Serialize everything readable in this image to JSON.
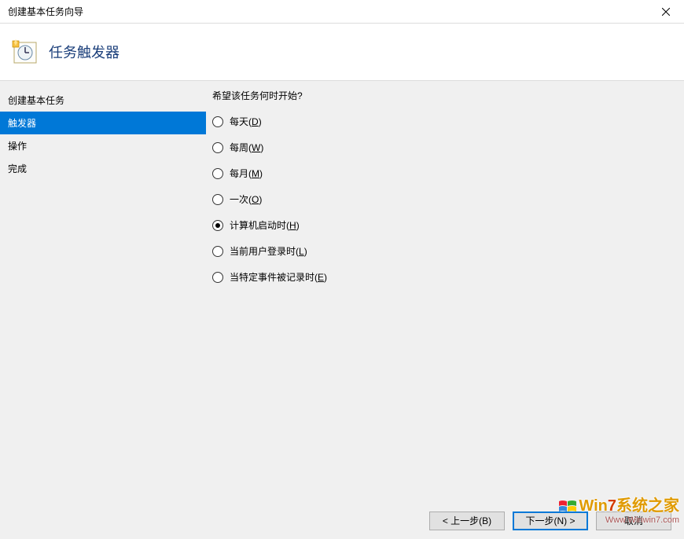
{
  "window": {
    "title": "创建基本任务向导"
  },
  "header": {
    "title": "任务触发器"
  },
  "sidebar": {
    "items": [
      {
        "label": "创建基本任务"
      },
      {
        "label": "触发器"
      },
      {
        "label": "操作"
      },
      {
        "label": "完成"
      }
    ],
    "selectedIndex": 1
  },
  "content": {
    "question": "希望该任务何时开始?",
    "options": [
      {
        "label": "每天",
        "accel": "D"
      },
      {
        "label": "每周",
        "accel": "W"
      },
      {
        "label": "每月",
        "accel": "M"
      },
      {
        "label": "一次",
        "accel": "O"
      },
      {
        "label": "计算机启动时",
        "accel": "H"
      },
      {
        "label": "当前用户登录时",
        "accel": "L"
      },
      {
        "label": "当特定事件被记录时",
        "accel": "E"
      }
    ],
    "selectedIndex": 4
  },
  "footer": {
    "back": "< 上一步(B)",
    "next": "下一步(N) >",
    "cancel": "取消"
  },
  "watermark": {
    "line1_prefix": "Win",
    "line1_brand": "7",
    "line1_suffix": "系统之家",
    "line2": "Www.Winwin7.com"
  }
}
